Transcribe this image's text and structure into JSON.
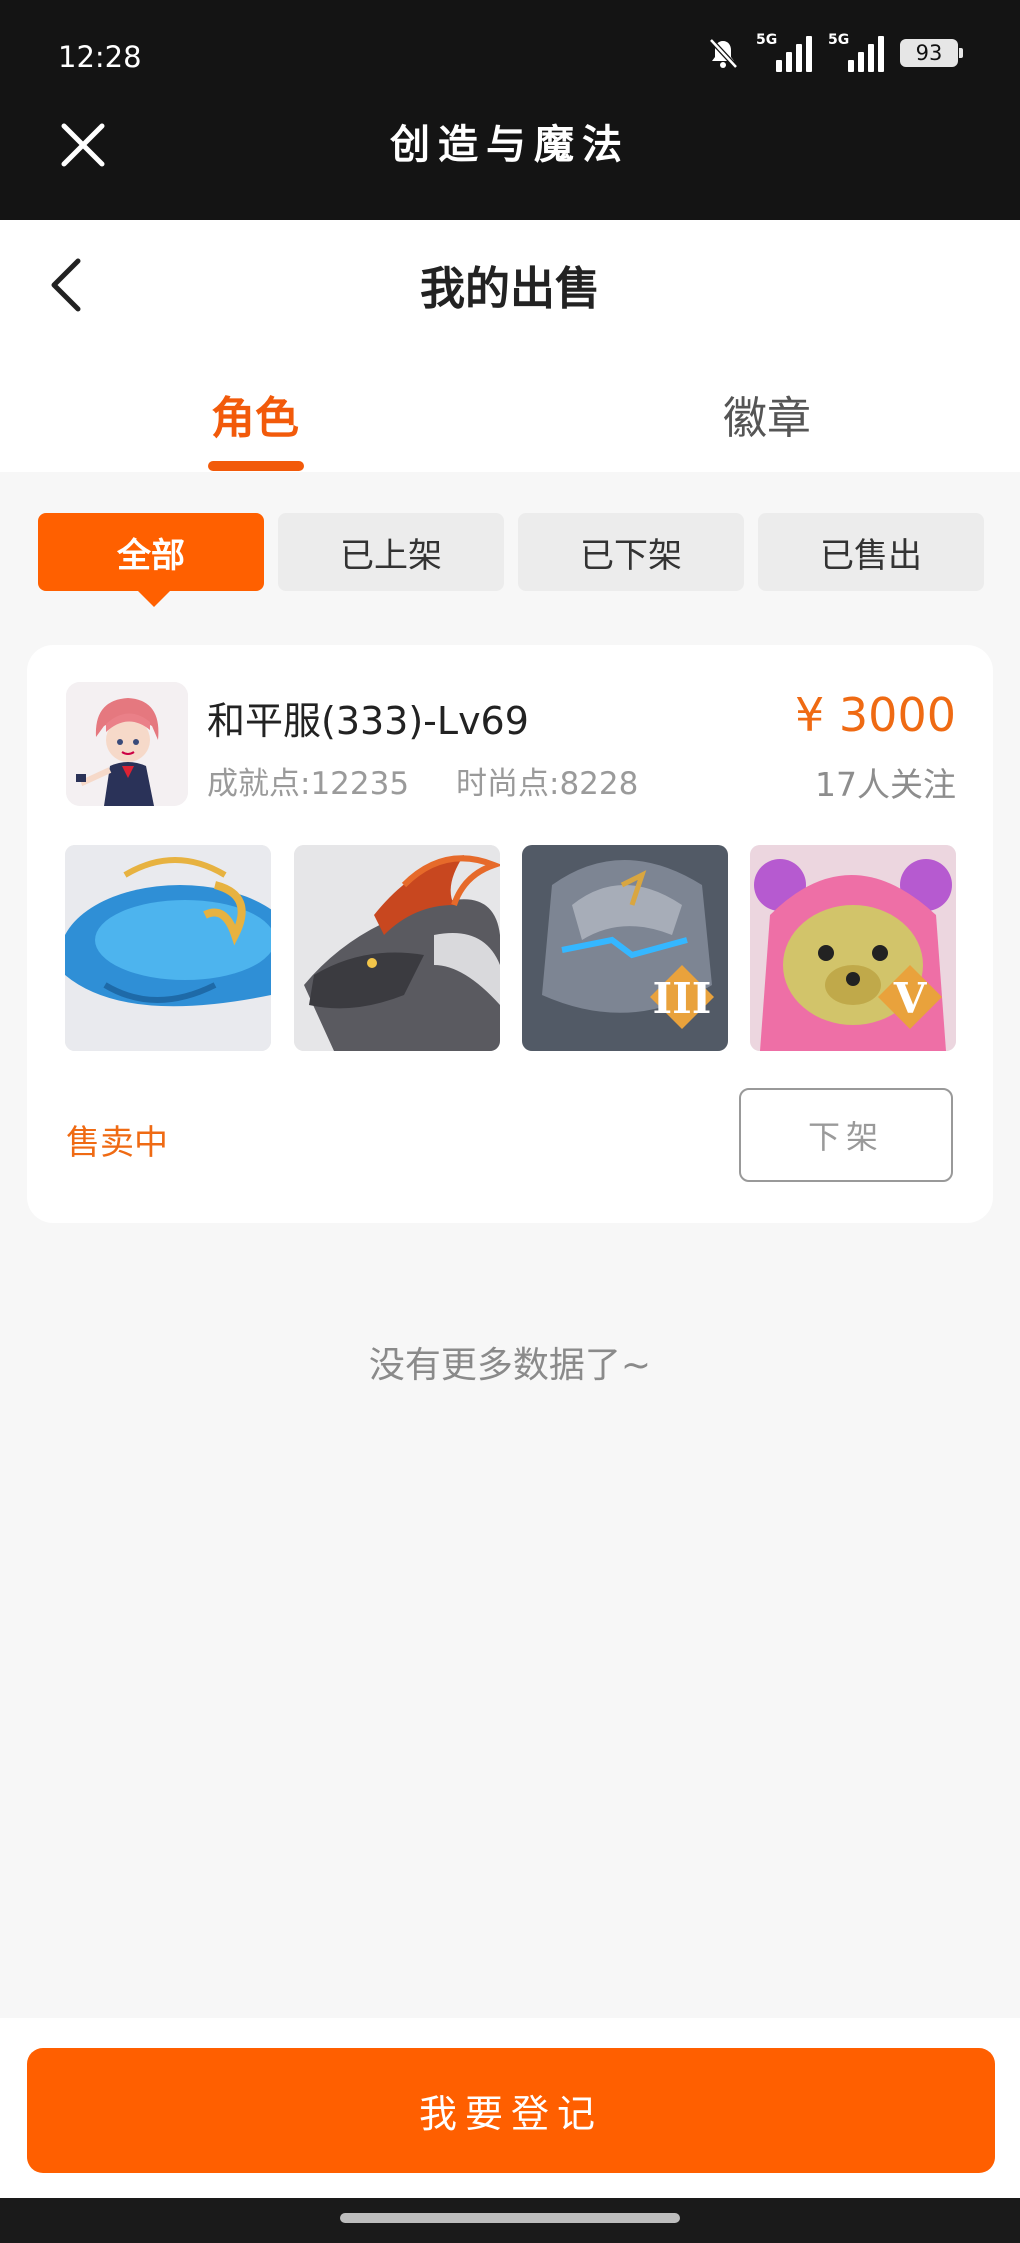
{
  "status_bar": {
    "time": "12:28",
    "battery": "93",
    "net1": "5G",
    "net2": "5G"
  },
  "app_bar": {
    "title": "创造与魔法"
  },
  "page": {
    "title": "我的出售"
  },
  "tabs": [
    {
      "label": "角色"
    },
    {
      "label": "徽章"
    }
  ],
  "filters": [
    {
      "label": "全部"
    },
    {
      "label": "已上架"
    },
    {
      "label": "已下架"
    },
    {
      "label": "已售出"
    }
  ],
  "listing": {
    "name": "和平服(333)-Lv69",
    "achievement": "成就点:12235",
    "fashion": "时尚点:8228",
    "price": "¥ 3000",
    "followers": "17人关注",
    "status": "售卖中",
    "action": "下架",
    "thumb_badges": [
      "",
      "",
      "III",
      "V"
    ]
  },
  "footer_note": "没有更多数据了~",
  "primary_action": "我要登记",
  "colors": {
    "accent": "#ff6000",
    "price": "#ef6a13"
  }
}
